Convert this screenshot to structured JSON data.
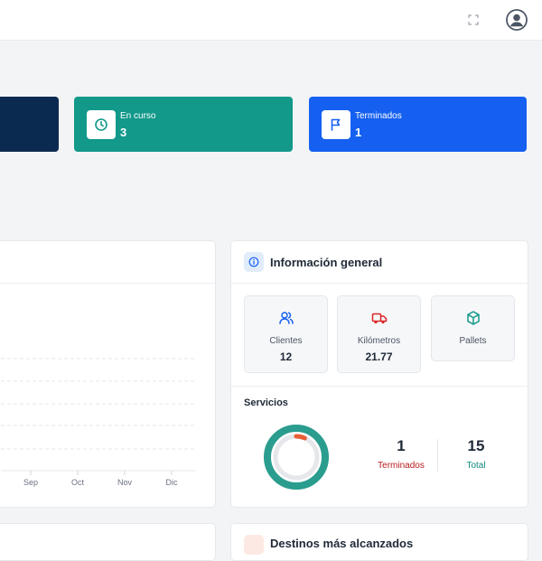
{
  "stats": [
    {
      "label": "En curso",
      "value": "3",
      "icon": "clock-icon"
    },
    {
      "label": "Terminados",
      "value": "1",
      "icon": "flag-icon"
    }
  ],
  "chart_data": {
    "type": "line",
    "categories": [
      "Sep",
      "Oct",
      "Nov",
      "Dic"
    ],
    "series": [],
    "grid": true,
    "title": "",
    "xlabel": "",
    "ylabel": ""
  },
  "info": {
    "title": "Información general",
    "icon": "info-icon",
    "metrics": [
      {
        "label": "Clientes",
        "value": "12",
        "icon": "users-icon",
        "color": "#1560f0"
      },
      {
        "label": "Kilómetros",
        "value": "21.77",
        "icon": "truck-icon",
        "color": "#dc2626"
      },
      {
        "label": "Pallets",
        "icon": "box-icon",
        "color": "#12998a"
      }
    ],
    "services": {
      "title": "Servicios",
      "finished_value": "1",
      "finished_label": "Terminados",
      "finished_color": "#b91c1c",
      "total_value": "15",
      "total_label": "Total",
      "total_color": "#0e8a80",
      "ring_color": "#2a9d8f",
      "progress_color": "#e85f36"
    }
  },
  "bottom": {
    "right_title": "Destinos más alcanzados"
  }
}
